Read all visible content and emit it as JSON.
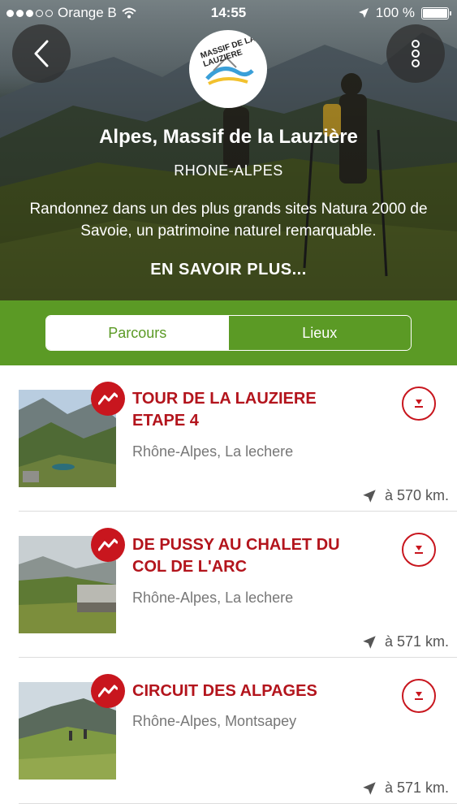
{
  "status": {
    "carrier": "Orange B",
    "time": "14:55",
    "battery": "100 %"
  },
  "hero": {
    "logo_text": "MASSIF DE LA LAUZIERE",
    "title": "Alpes, Massif de la Lauzière",
    "region": "RHONE-ALPES",
    "description": "Randonnez dans un des plus grands sites Natura 2000 de Savoie, un patrimoine naturel remarquable.",
    "more_label": "EN SAVOIR PLUS..."
  },
  "tabs": [
    {
      "label": "Parcours",
      "active": true
    },
    {
      "label": "Lieux",
      "active": false
    }
  ],
  "routes": [
    {
      "title": "TOUR DE LA LAUZIERE ETAPE 4",
      "location": "Rhône-Alpes, La lechere",
      "distance": "à 570 km."
    },
    {
      "title": "DE PUSSY AU CHALET DU COL DE L'ARC",
      "location": "Rhône-Alpes, La lechere",
      "distance": "à 571 km."
    },
    {
      "title": "CIRCUIT DES ALPAGES",
      "location": "Rhône-Alpes, Montsapey",
      "distance": "à 571 km."
    }
  ],
  "colors": {
    "brand_green": "#5b9a25",
    "accent_red": "#c8161e"
  },
  "icons": [
    "back-icon",
    "more-vertical-icon",
    "route-icon",
    "download-icon",
    "location-arrow-icon",
    "wifi-icon"
  ]
}
